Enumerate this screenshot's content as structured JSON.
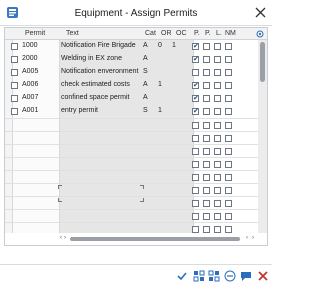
{
  "window": {
    "title": "Equipment - Assign Permits"
  },
  "columns": {
    "permit": "Permit",
    "text": "Text",
    "cat": "Cat",
    "or": "OR",
    "oc": "OC",
    "p1": "P.",
    "p2": "P.",
    "l": "L.",
    "nm": "NM"
  },
  "rows": [
    {
      "permit": "1000",
      "text": "Notification Fire Brigade",
      "cat": "A",
      "or": "0",
      "oc": "1",
      "p1": true,
      "p2": false,
      "l": false,
      "nm": false
    },
    {
      "permit": "2000",
      "text": "Welding in EX zone",
      "cat": "A",
      "or": "",
      "oc": "",
      "p1": true,
      "p2": false,
      "l": false,
      "nm": false
    },
    {
      "permit": "A005",
      "text": "Notification enveronment",
      "cat": "S",
      "or": "",
      "oc": "",
      "p1": false,
      "p2": false,
      "l": false,
      "nm": false
    },
    {
      "permit": "A006",
      "text": "check estimated costs",
      "cat": "A",
      "or": "1",
      "oc": "",
      "p1": true,
      "p2": false,
      "l": false,
      "nm": false
    },
    {
      "permit": "A007",
      "text": "confined space permit",
      "cat": "A",
      "or": "",
      "oc": "",
      "p1": true,
      "p2": false,
      "l": false,
      "nm": false
    },
    {
      "permit": "A001",
      "text": "entry permit",
      "cat": "S",
      "or": "1",
      "oc": "",
      "p1": true,
      "p2": false,
      "l": false,
      "nm": false
    }
  ],
  "icons": {
    "title": "app-icon",
    "close": "close-icon",
    "settings": "table-settings-icon",
    "footer": [
      "checkmark-icon",
      "tree-icon",
      "hierarchy-icon",
      "minus-icon",
      "comment-icon",
      "delete-icon",
      "cancel-icon"
    ]
  },
  "colors": {
    "accent": "#2a6ebb",
    "delete": "#c0392b",
    "grid": "#e6e6e6"
  }
}
